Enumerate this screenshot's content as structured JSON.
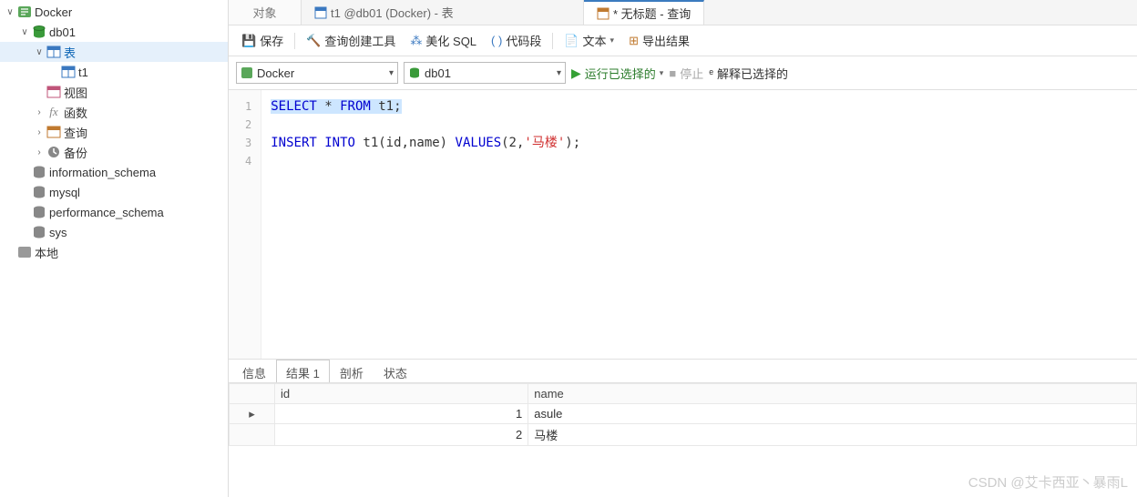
{
  "tree": {
    "conn": "Docker",
    "db": "db01",
    "tables_label": "表",
    "table1": "t1",
    "views": "视图",
    "functions": "函数",
    "queries": "查询",
    "backups": "备份",
    "info_schema": "information_schema",
    "mysql": "mysql",
    "perf_schema": "performance_schema",
    "sys": "sys",
    "local": "本地"
  },
  "tabs": {
    "objects": "对象",
    "table_tab": "t1 @db01 (Docker) - 表",
    "query_tab": "* 无标题 - 查询"
  },
  "toolbar": {
    "save": "保存",
    "querybuilder": "查询创建工具",
    "beautify": "美化 SQL",
    "snippets": "代码段",
    "text": "文本",
    "export": "导出结果"
  },
  "conn": {
    "connection": "Docker",
    "database": "db01",
    "run": "运行已选择的",
    "stop": "停止",
    "explain": "解释已选择的"
  },
  "sql": {
    "line1_kw1": "SELECT",
    "line1_star": " * ",
    "line1_kw2": "FROM",
    "line1_rest": " t1;",
    "line3_kw1": "INSERT",
    "line3_kw2": " INTO",
    "line3_rest1": " t1(id,name) ",
    "line3_kw3": "VALUES",
    "line3_rest2": "(2,",
    "line3_str": "'马楼'",
    "line3_rest3": ");"
  },
  "result_tabs": {
    "info": "信息",
    "result1": "结果 1",
    "profile": "剖析",
    "status": "状态"
  },
  "grid": {
    "col_id": "id",
    "col_name": "name",
    "rows": [
      {
        "id": "1",
        "name": "asule"
      },
      {
        "id": "2",
        "name": "马楼"
      }
    ]
  },
  "watermark": "CSDN @艾卡西亚丶暴雨L"
}
